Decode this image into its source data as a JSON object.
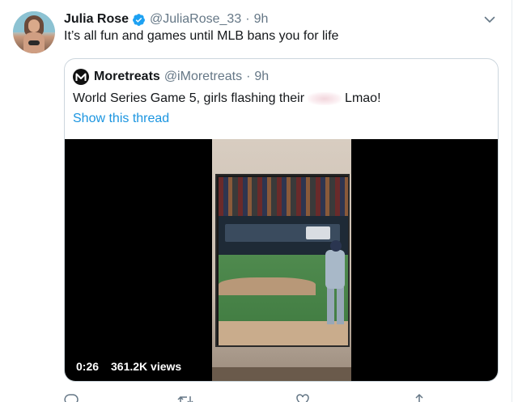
{
  "tweet": {
    "display_name": "Julia Rose",
    "handle": "@JuliaRose_33",
    "separator": "·",
    "time": "9h",
    "text": "It’s all fun and games until MLB bans you for life"
  },
  "quoted_tweet": {
    "display_name": "Moretreats",
    "handle": "@iMoretreats",
    "separator": "·",
    "time": "9h",
    "text_before": "World Series Game 5, girls flashing their",
    "text_after": "Lmao!",
    "show_thread_label": "Show this thread",
    "video": {
      "duration": "0:26",
      "views": "361.2K views"
    }
  },
  "actions": {
    "reply_count": "",
    "retweet_count": "",
    "like_count": ""
  },
  "icons": [
    "verified-icon",
    "chevron-down-icon",
    "reply-icon",
    "retweet-icon",
    "like-icon",
    "share-icon"
  ],
  "colors": {
    "link": "#1b95e0",
    "secondary_text": "#657786",
    "verified": "#1da1f2",
    "border": "#ccd6dd"
  }
}
